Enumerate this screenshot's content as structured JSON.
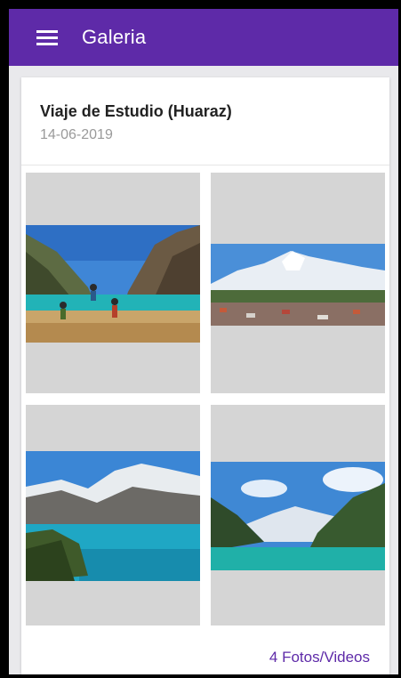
{
  "appbar": {
    "title": "Galeria",
    "color": "#5e2aa8",
    "menu_icon": "hamburger-menu-icon"
  },
  "album": {
    "title": "Viaje de Estudio (Huaraz)",
    "date": "14-06-2019",
    "count_label": "4 Fotos/Videos"
  },
  "photos": [
    {
      "subject": "people-jumping-at-lagoon"
    },
    {
      "subject": "snowy-mountain-over-town"
    },
    {
      "subject": "turquoise-lake-glacier-mountains"
    },
    {
      "subject": "valley-lake-snow-peak"
    }
  ]
}
